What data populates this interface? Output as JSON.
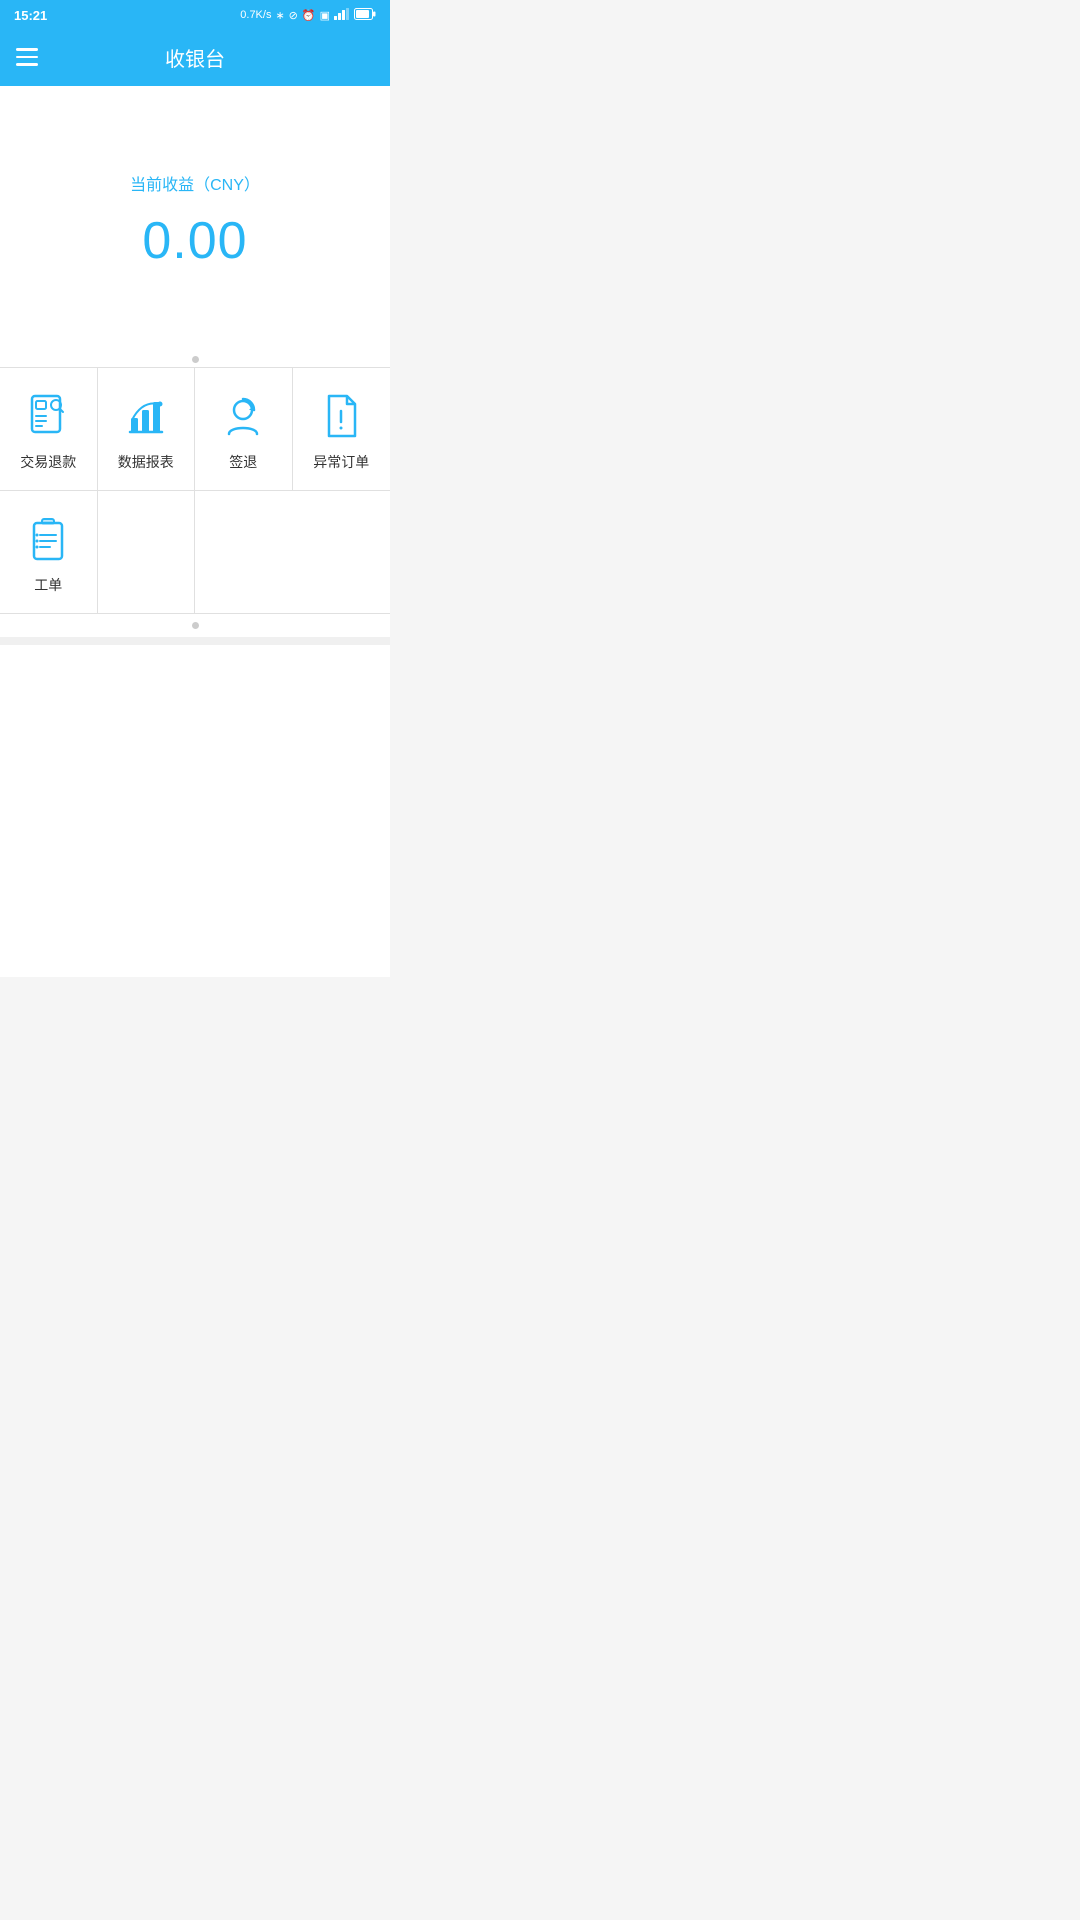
{
  "statusBar": {
    "time": "15:21",
    "rightIcons": "0.7K/s ✶ ⊘ ⏰ ▣ ▌▌ 🔋"
  },
  "topBar": {
    "menuIcon": "menu",
    "title": "收银台"
  },
  "revenue": {
    "label": "当前收益（CNY）",
    "amount": "0.00"
  },
  "gridItems": [
    {
      "id": "refund",
      "icon": "receipt",
      "label": "交易退款"
    },
    {
      "id": "report",
      "icon": "chart",
      "label": "数据报表"
    },
    {
      "id": "checkout",
      "icon": "person-check",
      "label": "签退"
    },
    {
      "id": "abnormal",
      "icon": "doc-alert",
      "label": "异常订单"
    },
    {
      "id": "workorder",
      "icon": "clipboard",
      "label": "工单"
    }
  ]
}
